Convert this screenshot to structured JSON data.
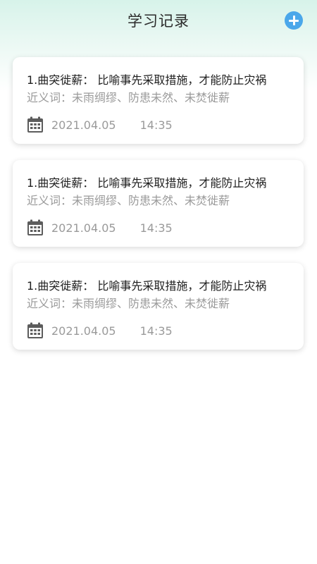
{
  "header": {
    "title": "学习记录",
    "add_icon": "plus-circle-icon",
    "accent": "#4aa7ea"
  },
  "records": [
    {
      "title": "1.曲突徙薪： 比喻事先采取措施，才能防止灾祸",
      "synonyms": "近义词：未雨绸缪、防患未然、未焚徙薪",
      "date": "2021.04.05",
      "time": "14:35",
      "icon": "calendar-icon"
    },
    {
      "title": "1.曲突徙薪： 比喻事先采取措施，才能防止灾祸",
      "synonyms": "近义词：未雨绸缪、防患未然、未焚徙薪",
      "date": "2021.04.05",
      "time": "14:35",
      "icon": "calendar-icon"
    },
    {
      "title": "1.曲突徙薪： 比喻事先采取措施，才能防止灾祸",
      "synonyms": "近义词：未雨绸缪、防患未然、未焚徙薪",
      "date": "2021.04.05",
      "time": "14:35",
      "icon": "calendar-icon"
    }
  ]
}
